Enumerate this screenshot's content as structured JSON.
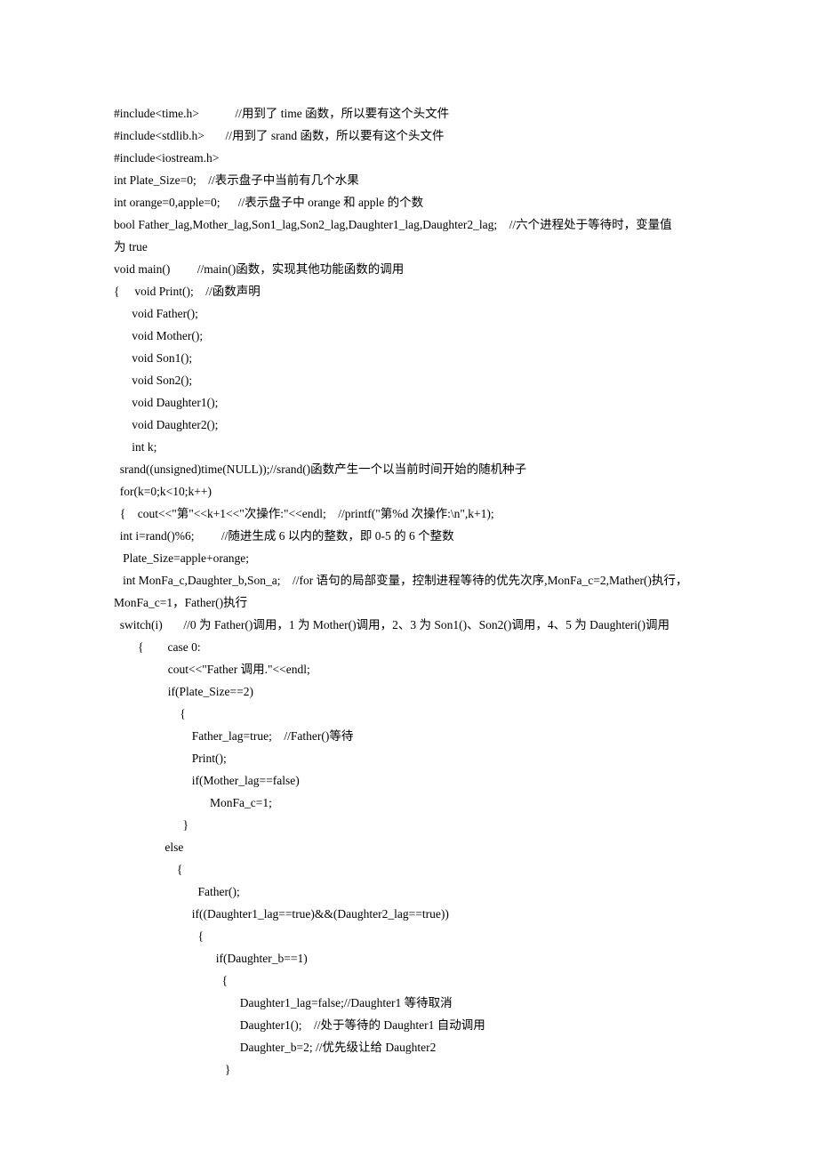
{
  "lines": [
    "#include<time.h>            //用到了 time 函数，所以要有这个头文件",
    "#include<stdlib.h>       //用到了 srand 函数，所以要有这个头文件",
    "#include<iostream.h>",
    "int Plate_Size=0;    //表示盘子中当前有几个水果",
    "int orange=0,apple=0;      //表示盘子中 orange 和 apple 的个数",
    "bool Father_lag,Mother_lag,Son1_lag,Son2_lag,Daughter1_lag,Daughter2_lag;    //六个进程处于等待时，变量值",
    "为 true",
    "void main()         //main()函数，实现其他功能函数的调用",
    "{     void Print();    //函数声明",
    "      void Father();",
    "      void Mother();",
    "      void Son1();",
    "      void Son2();",
    "      void Daughter1();",
    "      void Daughter2();",
    "      int k;",
    "  srand((unsigned)time(NULL));//srand()函数产生一个以当前时间开始的随机种子",
    "  for(k=0;k<10;k++)",
    "  {    cout<<\"第\"<<k+1<<\"次操作:\"<<endl;    //printf(\"第%d 次操作:\\n\",k+1);",
    "  int i=rand()%6;         //随进生成 6 以内的整数，即 0-5 的 6 个整数",
    "   Plate_Size=apple+orange;",
    "   int MonFa_c,Daughter_b,Son_a;    //for 语句的局部变量，控制进程等待的优先次序,MonFa_c=2,Mather()执行，",
    "MonFa_c=1，Father()执行",
    "  switch(i)       //0 为 Father()调用，1 为 Mother()调用，2、3 为 Son1()、Son2()调用，4、5 为 Daughteri()调用",
    "        {        case 0:",
    "                  cout<<\"Father 调用.\"<<endl;",
    "                  if(Plate_Size==2)",
    "                      {",
    "                          Father_lag=true;    //Father()等待",
    "                          Print();",
    "                          if(Mother_lag==false)",
    "                                MonFa_c=1;",
    "                       }",
    "                 else",
    "                     {",
    "                            Father();",
    "                          if((Daughter1_lag==true)&&(Daughter2_lag==true))",
    "                            {",
    "                                  if(Daughter_b==1)",
    "                                    {",
    "                                          Daughter1_lag=false;//Daughter1 等待取消",
    "                                          Daughter1();    //处于等待的 Daughter1 自动调用",
    "                                          Daughter_b=2; //优先级让给 Daughter2",
    "                                     }"
  ]
}
